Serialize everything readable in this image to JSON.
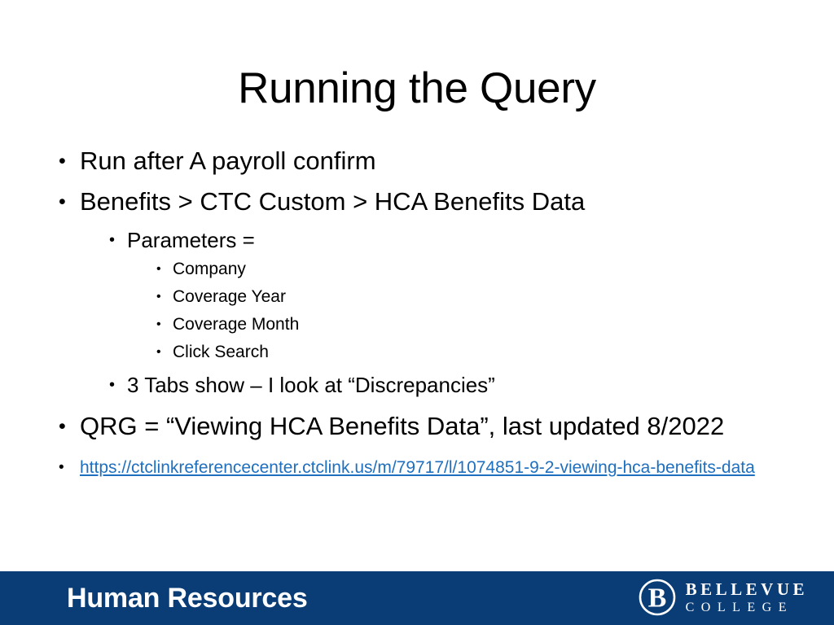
{
  "slide": {
    "title": "Running the Query",
    "bullets": [
      {
        "level": 1,
        "text": "Run after A payroll confirm"
      },
      {
        "level": 1,
        "text": "Benefits > CTC Custom > HCA Benefits Data"
      },
      {
        "level": 2,
        "text": "Parameters ="
      },
      {
        "level": 3,
        "text": "Company"
      },
      {
        "level": 3,
        "text": "Coverage Year"
      },
      {
        "level": 3,
        "text": "Coverage Month"
      },
      {
        "level": 3,
        "text": "Click Search"
      },
      {
        "level": 2,
        "text": "3 Tabs show – I look at “Discrepancies”"
      },
      {
        "level": 1,
        "text": "QRG = “Viewing HCA Benefits Data”, last updated 8/2022"
      }
    ],
    "bullet_glyph": "•",
    "link": {
      "text": "https://ctclinkreferencecenter.ctclink.us/m/79717/l/1074851-9-2-viewing-hca-benefits-data",
      "color": "#1F6FBF"
    }
  },
  "footer": {
    "title": "Human Resources",
    "background_color": "#0A3D76",
    "text_color": "#FFFFFF",
    "logo": {
      "monogram": "B",
      "line1": "BELLEVUE",
      "line2": "COLLEGE"
    }
  }
}
